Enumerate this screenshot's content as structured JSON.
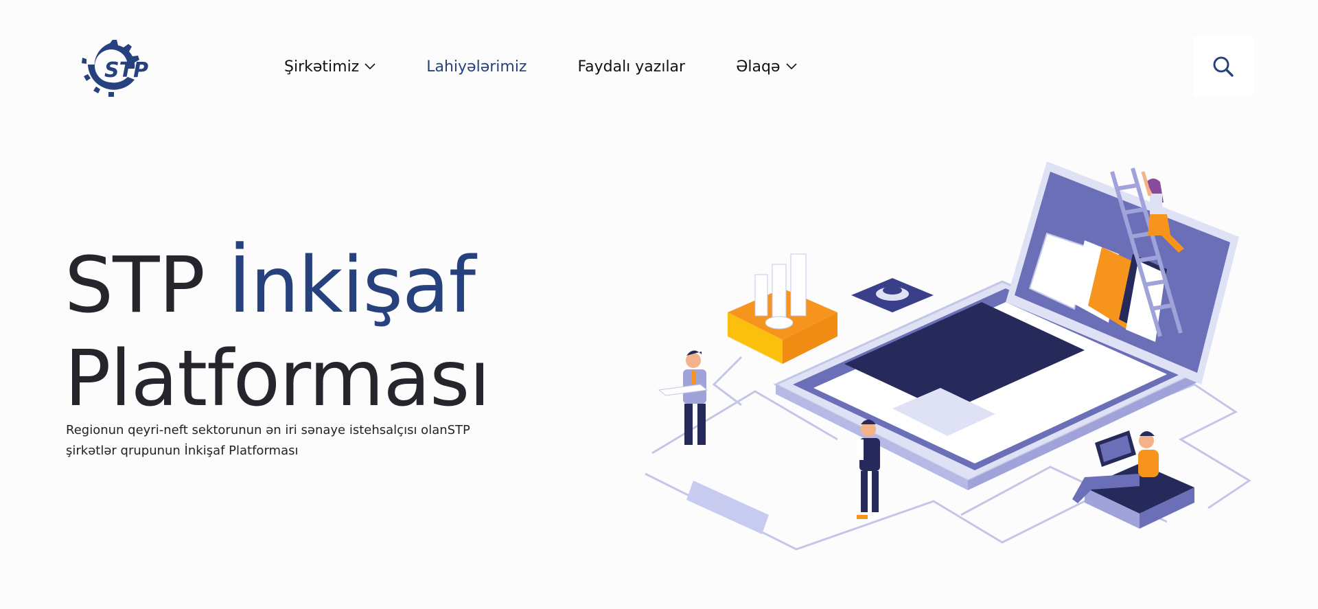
{
  "header": {
    "logo_text": "STP",
    "nav": [
      {
        "label": "Şirkətimiz",
        "has_dropdown": true,
        "active": false
      },
      {
        "label": "Lahiyələrimiz",
        "has_dropdown": false,
        "active": true
      },
      {
        "label": "Faydalı yazılar",
        "has_dropdown": false,
        "active": false
      },
      {
        "label": "Əlaqə",
        "has_dropdown": true,
        "active": false
      }
    ],
    "search_icon": "search-icon"
  },
  "hero": {
    "title_part1": "STP ",
    "title_accent": "İnkişaf",
    "title_line2": "Platforması",
    "subtitle_line1": "Regionun qeyri-neft sektorunun ən iri sənaye istehsalçısı olanSTP",
    "subtitle_line2": "şirkətlər qrupunun İnkişaf Platforması"
  },
  "colors": {
    "brand": "#27417f",
    "illustration_primary": "#6b6fb8",
    "illustration_dark": "#262a5a",
    "illustration_accent": "#f7941d",
    "illustration_light": "#dfe1f5"
  }
}
